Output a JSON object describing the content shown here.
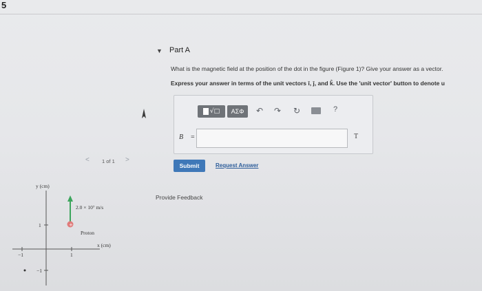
{
  "page_number": "5",
  "part": {
    "title": "Part A"
  },
  "question": "What is the magnetic field at the position of the dot in the figure (Figure 1)? Give your answer as a vector.",
  "instruction": "Express your answer in terms of the unit vectors î, ĵ, and k̂. Use the 'unit vector' button to denote u",
  "toolbar": {
    "templates_glyph": "√□",
    "greek_label": "ΑΣΦ",
    "undo_icon": "undo-icon",
    "redo_icon": "redo-icon",
    "reset_icon": "reset-icon",
    "keyboard_icon": "keyboard-icon",
    "help_label": "?"
  },
  "answer": {
    "label": "B⃗ =",
    "value": "",
    "unit": "T"
  },
  "buttons": {
    "submit": "Submit",
    "request_answer": "Request Answer"
  },
  "feedback_link": "Provide Feedback",
  "pager": {
    "text": "1 of 1",
    "prev": "<",
    "next": ">"
  },
  "figure": {
    "y_axis_label": "y (cm)",
    "x_axis_label": "x (cm)",
    "velocity_label": "2.0 × 10⁷ m/s",
    "particle_label": "Proton",
    "tick_y_pos": "1",
    "tick_y_neg": "−1",
    "tick_x_pos": "1",
    "tick_x_neg": "−1",
    "proton_color": "#e07a7a",
    "velocity_color": "#3ca55c"
  },
  "colors": {
    "submit_bg": "#3f78b8",
    "link": "#2d5d9a"
  }
}
